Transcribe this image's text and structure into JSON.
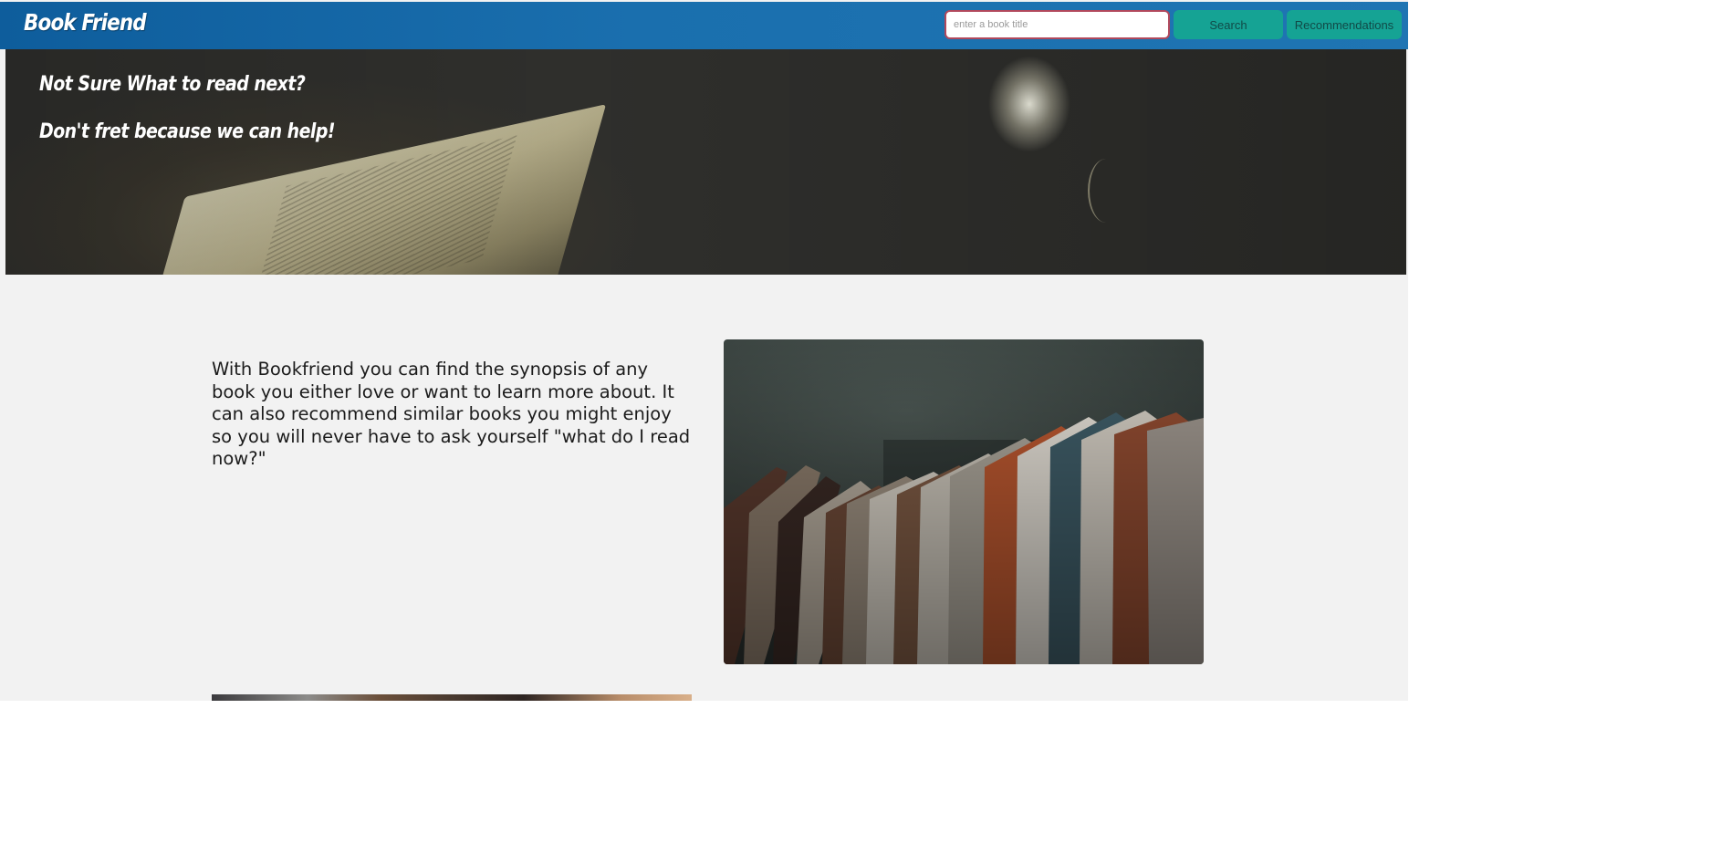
{
  "navbar": {
    "brand": "Book Friend",
    "search_placeholder": "enter a book title",
    "search_button": "Search",
    "recommendations_button": "Recommendations"
  },
  "hero": {
    "line1": "Not Sure What to read next?",
    "line2": "Don't fret because we can help!"
  },
  "intro": {
    "text": "With Bookfriend you can find the synopsis of any book you either love or want to learn more about. It can also recommend similar books you might enjoy so you will never have to ask yourself \"what do I read now?\""
  },
  "colors": {
    "navbar": "#1a6fae",
    "button": "#15a394",
    "page_background": "#f2f2f2"
  }
}
